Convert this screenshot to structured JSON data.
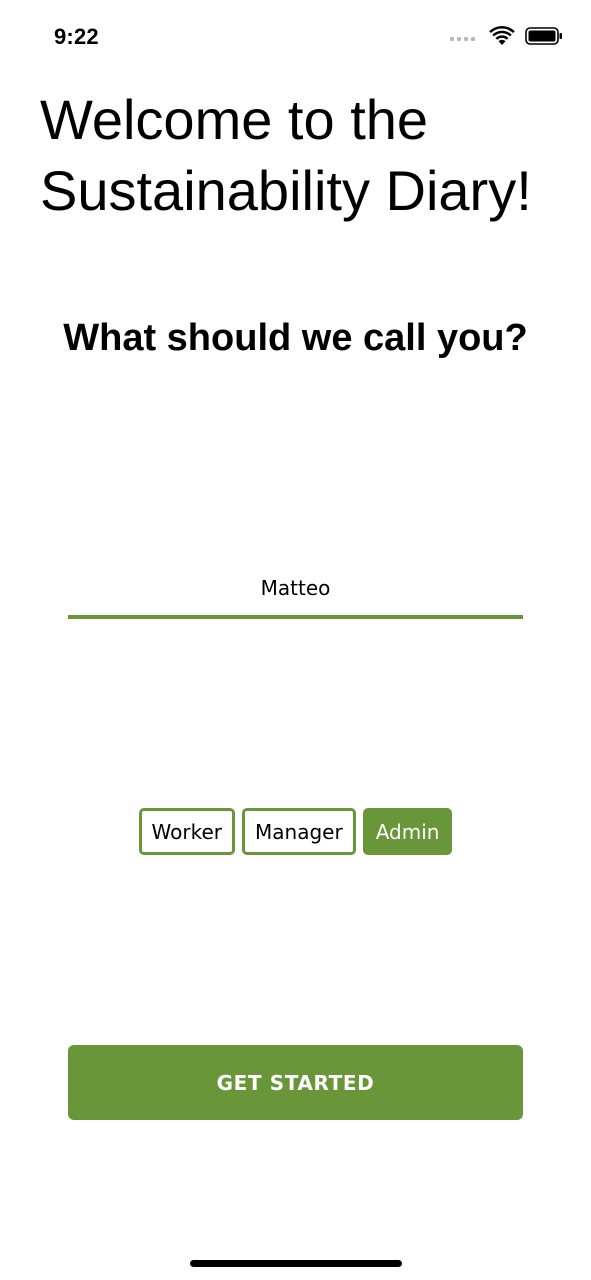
{
  "status_bar": {
    "time": "9:22",
    "icons": [
      "signal-icon",
      "wifi-icon",
      "battery-icon"
    ]
  },
  "welcome": {
    "title": "Welcome to the Sustainability Diary!"
  },
  "name_prompt": {
    "question": "What should we call you?",
    "input_value": "Matteo"
  },
  "roles": {
    "options": [
      "Worker",
      "Manager",
      "Admin"
    ],
    "selected": "Admin"
  },
  "actions": {
    "get_started_label": "GET STARTED"
  },
  "colors": {
    "accent": "#6a963a",
    "caret": "#3a6cf0",
    "background": "#ffffff",
    "text": "#000000"
  }
}
